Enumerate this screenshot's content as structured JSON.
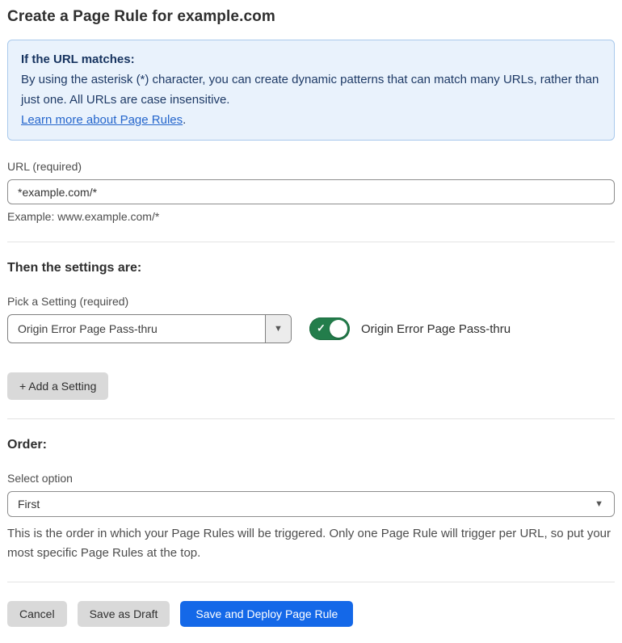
{
  "page": {
    "title": "Create a Page Rule for example.com"
  },
  "info_box": {
    "heading": "If the URL matches:",
    "body": "By using the asterisk (*) character, you can create dynamic patterns that can match many URLs, rather than just one. All URLs are case insensitive.",
    "link": "Learn more about Page Rules",
    "link_suffix": "."
  },
  "url_section": {
    "label": "URL (required)",
    "value": "*example.com/*",
    "helper": "Example: www.example.com/*"
  },
  "settings_section": {
    "heading": "Then the settings are:",
    "picker_label": "Pick a Setting (required)",
    "selected_setting": "Origin Error Page Pass-thru",
    "toggle_state": "on",
    "toggle_check_glyph": "✓",
    "toggle_label": "Origin Error Page Pass-thru",
    "add_button_label": "+ Add a Setting"
  },
  "order_section": {
    "heading": "Order:",
    "select_label": "Select option",
    "selected_option": "First",
    "helper": "This is the order in which your Page Rules will be triggered. Only one Page Rule will trigger per URL, so put your most specific Page Rules at the top."
  },
  "footer": {
    "cancel_label": "Cancel",
    "save_draft_label": "Save as Draft",
    "save_deploy_label": "Save and Deploy Page Rule"
  },
  "icons": {
    "dropdown_caret": "▼"
  },
  "colors": {
    "accent_blue": "#1468e8",
    "toggle_green": "#237d4b",
    "info_bg": "#e9f2fc",
    "info_border": "#a9c9ec",
    "info_text": "#1e3a66",
    "link_blue": "#2566cc",
    "button_gray": "#d9d9d9"
  }
}
